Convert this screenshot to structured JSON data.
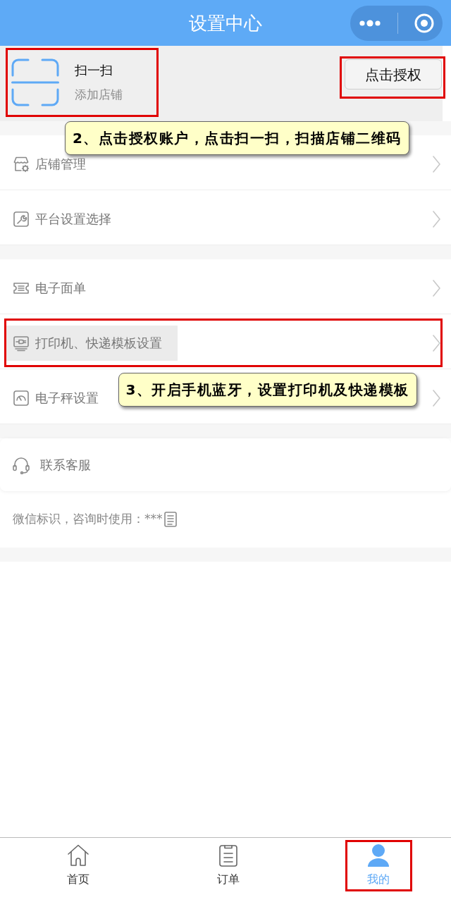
{
  "header": {
    "title": "设置中心"
  },
  "scan": {
    "title": "扫一扫",
    "subtitle": "添加店铺",
    "outlined": true,
    "auth_button": {
      "label": "点击授权",
      "outlined": true
    },
    "note": "2、点击授权账户，点击扫一扫，扫描店铺二维码"
  },
  "groups": [
    {
      "items": [
        {
          "label": "店铺管理",
          "outlined": false,
          "highlighted": false
        },
        {
          "label": "平台设置选择",
          "outlined": false,
          "highlighted": false
        }
      ]
    },
    {
      "items": [
        {
          "label": "电子面单",
          "outlined": false,
          "highlighted": false
        },
        {
          "label": "打印机、快递模板设置",
          "outlined": true,
          "highlighted": true
        },
        {
          "label": "电子秤设置",
          "outlined": false,
          "highlighted": false,
          "note": "3、开启手机蓝牙，设置打印机及快递模板"
        }
      ]
    }
  ],
  "contact": {
    "label": "联系客服"
  },
  "wechat_id": {
    "text": "微信标识，咨询时使用：***"
  },
  "tabs": [
    {
      "label": "首页",
      "selected": false,
      "outlined": false
    },
    {
      "label": "订单",
      "selected": false,
      "outlined": false
    },
    {
      "label": "我的",
      "selected": true,
      "outlined": true
    }
  ]
}
